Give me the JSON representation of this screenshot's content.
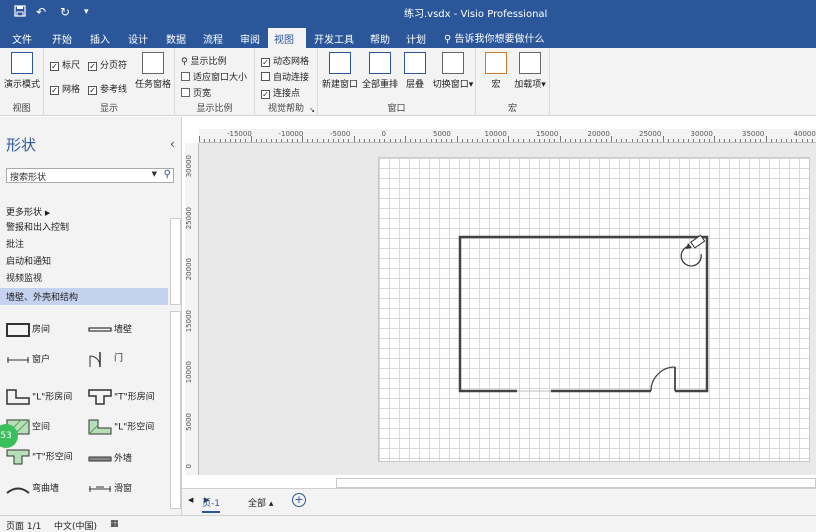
{
  "titlebar": {
    "title": "练习.vsdx  -  Visio Professional",
    "save_icon": "save-icon",
    "undo_icon": "undo-icon",
    "redo_icon": "redo-icon",
    "customize_icon": "customize-qat-icon"
  },
  "tabs": [
    "文件",
    "开始",
    "插入",
    "设计",
    "数据",
    "流程",
    "审阅",
    "视图",
    "开发工具",
    "帮助",
    "计划"
  ],
  "active_tab": "视图",
  "tell_me": "告诉我你想要做什么",
  "ribbon": {
    "views_group": {
      "label": "视图",
      "present_mode": "演示模式"
    },
    "show_group": {
      "label": "显示",
      "ruler": "标尺",
      "page_breaks": "分页符",
      "grid": "网格",
      "guides": "参考线",
      "task_panes": "任务窗格"
    },
    "zoom_group": {
      "label": "显示比例",
      "zoom": "显示比例",
      "fit_to_window": "适应窗口大小",
      "page_width": "页宽"
    },
    "visual_aids_group": {
      "label": "视觉帮助",
      "dynamic_grid": "动态网格",
      "auto_connect": "自动连接",
      "connection_points": "连接点"
    },
    "window_group": {
      "label": "窗口",
      "new_window": "新建窗口",
      "arrange_all": "全部重排",
      "cascade": "层叠",
      "switch_windows": "切换窗口"
    },
    "macros_group": {
      "label": "宏",
      "macros": "宏",
      "addins": "加载项"
    }
  },
  "shapes_pane": {
    "title": "形状",
    "search_placeholder": "搜索形状",
    "more_shapes": "更多形状",
    "stencils": [
      "警报和出入控制",
      "批注",
      "启动和通知",
      "视频监视",
      "墙壁、外壳和结构"
    ],
    "selected_stencil": "墙壁、外壳和结构",
    "shapes": [
      {
        "label": "房间"
      },
      {
        "label": "墙壁"
      },
      {
        "label": "窗户"
      },
      {
        "label": "门"
      },
      {
        "label": "\"L\"形房间"
      },
      {
        "label": "\"T\"形房间"
      },
      {
        "label": "空间"
      },
      {
        "label": "\"L\"形空间"
      },
      {
        "label": "\"T\"形空间"
      },
      {
        "label": "外墙"
      },
      {
        "label": "弯曲墙"
      },
      {
        "label": "滑窗"
      }
    ]
  },
  "rulers": {
    "horizontal": [
      "-15000",
      "-10000",
      "-5000",
      "0",
      "5000",
      "10000",
      "15000",
      "20000",
      "25000",
      "30000",
      "35000",
      "40000"
    ],
    "vertical": [
      "30000",
      "25000",
      "20000",
      "15000",
      "10000",
      "5000",
      "0"
    ]
  },
  "page_tabs": {
    "page": "页-1",
    "all": "全部",
    "add_icon": "add-page-icon"
  },
  "status": {
    "page": "页面 1/1",
    "language": "中文(中国)"
  },
  "badge": "53"
}
